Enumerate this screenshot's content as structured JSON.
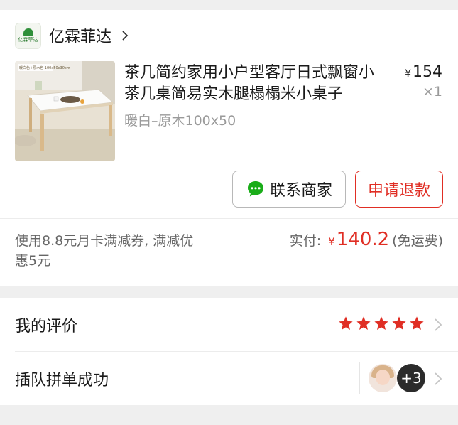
{
  "store": {
    "logo_text": "亿霖菲达",
    "name": "亿霖菲达",
    "chevron": "chevron-right-icon"
  },
  "product": {
    "title": "茶几简约家用小户型客厅日式飘窗小茶几桌简易实木腿榻榻米小桌子",
    "spec": "暖白–原木100x50",
    "price_currency": "¥",
    "price": "154",
    "quantity": "×1",
    "image_caption": "暖白色+原木色 100x50x30cm"
  },
  "actions": {
    "contact_label": "联系商家",
    "contact_icon": "chat-bubble-icon",
    "refund_label": "申请退款"
  },
  "payment": {
    "discount_text": "使用8.8元月卡满减券, 满减优惠5元",
    "paid_label": "实付:",
    "paid_currency": "¥",
    "paid_amount": "140.2",
    "shipping_note": "(免运费)"
  },
  "review": {
    "label": "我的评价",
    "stars": 5,
    "star_color": "#e02e24"
  },
  "group": {
    "label": "插队拼单成功",
    "more_count": "+3"
  },
  "colors": {
    "accent": "#e02e24",
    "background": "#efefef",
    "muted": "#9a9a9a"
  }
}
